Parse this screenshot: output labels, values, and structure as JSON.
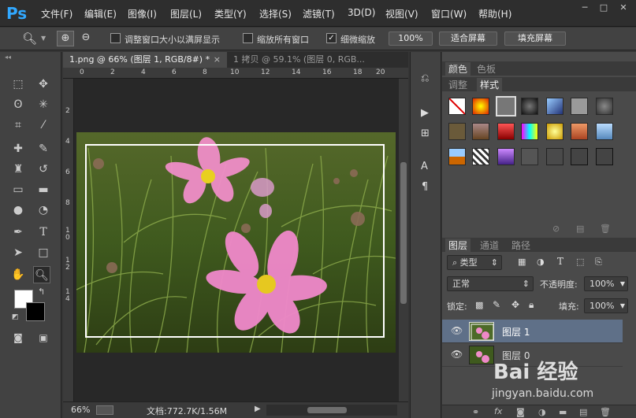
{
  "app": {
    "logo": "Ps"
  },
  "menu": [
    "文件(F)",
    "编辑(E)",
    "图像(I)",
    "图层(L)",
    "类型(Y)",
    "选择(S)",
    "滤镜(T)",
    "3D(D)",
    "视图(V)",
    "窗口(W)",
    "帮助(H)"
  ],
  "window_controls": {
    "minimize": "─",
    "maximize": "□",
    "close": "✕"
  },
  "options": {
    "resize_windows_label": "调整窗口大小以满屏显示",
    "zoom_all_label": "缩放所有窗口",
    "scrubby_zoom_label": "细微缩放",
    "scrubby_zoom_checked": true,
    "btn_100": "100%",
    "btn_fit_screen": "适合屏幕",
    "btn_fill_screen": "填充屏幕"
  },
  "tabs": {
    "active": "1.png @ 66% (图层 1, RGB/8#) *",
    "active_close": "×",
    "inactive": "1 拷贝 @ 59.1% (图层 0, RGB..."
  },
  "ruler": {
    "top": [
      "0",
      "2",
      "4",
      "6",
      "8",
      "10",
      "12",
      "14",
      "16",
      "18",
      "20"
    ],
    "left": [
      "2",
      "4",
      "6",
      "8",
      "1",
      "0",
      "1",
      "2",
      "1",
      "4"
    ]
  },
  "status": {
    "zoom": "66%",
    "doc": "文档:772.7K/1.56M"
  },
  "panels": {
    "color_tab": "颜色",
    "swatches_tab": "色板",
    "adjust_tab": "调整",
    "styles_tab": "样式",
    "layers_tab": "图层",
    "channels_tab": "通道",
    "paths_tab": "路径",
    "filter_type": "类型",
    "blend_mode": "正常",
    "opacity_label": "不透明度:",
    "opacity_value": "100%",
    "lock_label": "锁定:",
    "fill_label": "填充:",
    "fill_value": "100%"
  },
  "layers": [
    {
      "name": "图层 1",
      "selected": true
    },
    {
      "name": "图层 0",
      "selected": false
    }
  ],
  "watermark": {
    "logo": "Bai 经验",
    "url": "jingyan.baidu.com"
  },
  "colors": {
    "accent": "#31a8ff",
    "selected_layer": "#5f7088",
    "selection_frame": "#ffffff"
  }
}
